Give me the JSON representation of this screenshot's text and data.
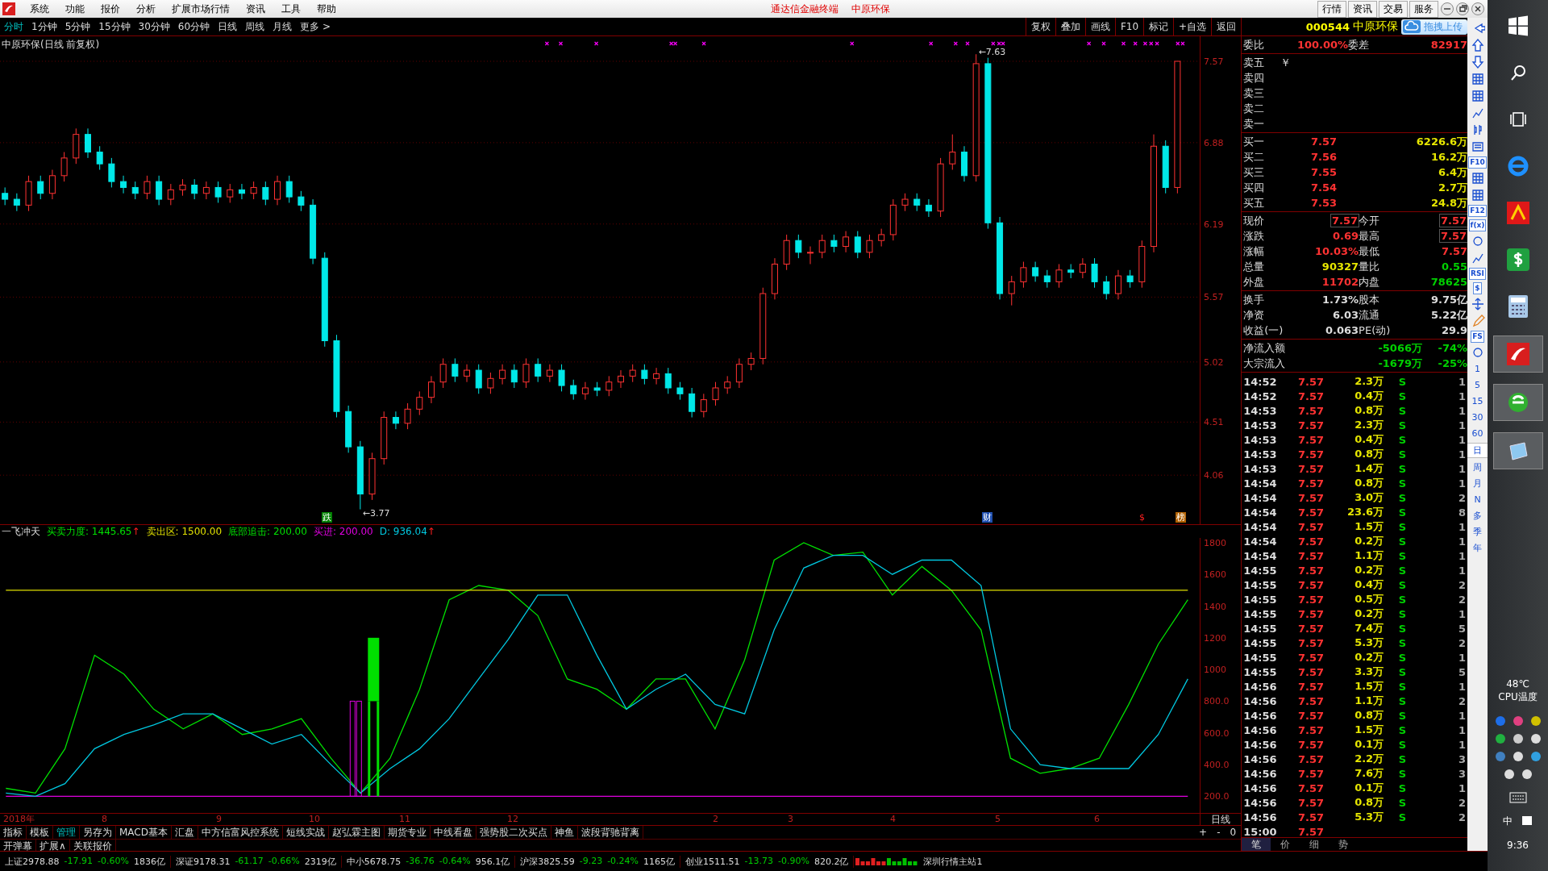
{
  "menu": {
    "items": [
      "系统",
      "功能",
      "报价",
      "分析",
      "扩展市场行情",
      "资讯",
      "工具",
      "帮助"
    ],
    "title_right": [
      "通达信金融终端",
      "中原环保"
    ],
    "buttons": [
      "行情",
      "资讯",
      "交易",
      "服务"
    ]
  },
  "periods": [
    {
      "label": "分时",
      "selected": true
    },
    {
      "label": "1分钟",
      "selected": false
    },
    {
      "label": "5分钟",
      "selected": false
    },
    {
      "label": "15分钟",
      "selected": false
    },
    {
      "label": "30分钟",
      "selected": false
    },
    {
      "label": "60分钟",
      "selected": false
    },
    {
      "label": "日线",
      "selected": false
    },
    {
      "label": "周线",
      "selected": false
    },
    {
      "label": "月线",
      "selected": false
    },
    {
      "label": "更多 >",
      "selected": false
    }
  ],
  "chart_tools": [
    "复权",
    "叠加",
    "画线",
    "F10",
    "标记",
    "+自选",
    "返回"
  ],
  "main_chart": {
    "title": "中原环保(日线 前复权)",
    "chart_data": {
      "type": "candlestick",
      "categories": [
        null,
        null,
        null,
        null,
        null,
        null,
        null,
        null,
        null,
        null,
        null,
        null,
        null,
        null,
        null,
        null,
        null,
        null,
        null,
        null,
        null,
        null,
        null,
        null,
        null,
        null,
        null,
        null,
        null,
        null,
        null,
        null,
        null,
        null,
        null,
        null,
        null,
        null,
        null,
        null,
        null,
        null,
        null,
        null,
        null,
        null,
        null,
        null,
        null,
        null,
        null,
        null,
        null,
        null,
        null,
        null,
        null,
        null,
        null,
        null,
        null,
        null,
        null,
        null,
        null,
        null,
        null,
        null,
        null,
        null,
        null,
        null,
        null,
        null,
        null,
        null,
        null,
        null,
        null,
        null,
        null,
        null,
        null,
        null,
        null,
        null,
        null,
        null,
        null,
        null,
        null,
        null,
        null,
        null,
        null,
        null,
        null,
        null,
        null,
        null
      ],
      "ohlc": [
        [
          6.45,
          6.5,
          6.35,
          6.4
        ],
        [
          6.4,
          6.45,
          6.3,
          6.35
        ],
        [
          6.35,
          6.6,
          6.3,
          6.55
        ],
        [
          6.55,
          6.6,
          6.4,
          6.45
        ],
        [
          6.45,
          6.65,
          6.4,
          6.6
        ],
        [
          6.6,
          6.8,
          6.55,
          6.75
        ],
        [
          6.75,
          7.0,
          6.7,
          6.95
        ],
        [
          6.95,
          7.0,
          6.75,
          6.8
        ],
        [
          6.8,
          6.85,
          6.65,
          6.7
        ],
        [
          6.7,
          6.75,
          6.5,
          6.55
        ],
        [
          6.55,
          6.6,
          6.45,
          6.5
        ],
        [
          6.5,
          6.55,
          6.4,
          6.45
        ],
        [
          6.45,
          6.6,
          6.4,
          6.55
        ],
        [
          6.55,
          6.6,
          6.35,
          6.4
        ],
        [
          6.4,
          6.53,
          6.35,
          6.48
        ],
        [
          6.48,
          6.57,
          6.43,
          6.52
        ],
        [
          6.52,
          6.57,
          6.4,
          6.45
        ],
        [
          6.45,
          6.55,
          6.4,
          6.5
        ],
        [
          6.5,
          6.55,
          6.37,
          6.42
        ],
        [
          6.42,
          6.53,
          6.37,
          6.48
        ],
        [
          6.48,
          6.53,
          6.4,
          6.45
        ],
        [
          6.45,
          6.55,
          6.4,
          6.5
        ],
        [
          6.5,
          6.55,
          6.35,
          6.4
        ],
        [
          6.4,
          6.6,
          6.35,
          6.55
        ],
        [
          6.55,
          6.6,
          6.37,
          6.42
        ],
        [
          6.42,
          6.47,
          6.3,
          6.35
        ],
        [
          6.35,
          6.4,
          5.85,
          5.9
        ],
        [
          5.9,
          5.95,
          5.15,
          5.2
        ],
        [
          5.2,
          5.25,
          4.55,
          4.6
        ],
        [
          4.6,
          4.65,
          4.25,
          4.3
        ],
        [
          4.3,
          4.35,
          3.77,
          3.9
        ],
        [
          3.9,
          4.25,
          3.85,
          4.2
        ],
        [
          4.2,
          4.6,
          4.15,
          4.55
        ],
        [
          4.55,
          4.6,
          4.45,
          4.5
        ],
        [
          4.5,
          4.67,
          4.45,
          4.62
        ],
        [
          4.62,
          4.77,
          4.57,
          4.72
        ],
        [
          4.72,
          4.9,
          4.67,
          4.85
        ],
        [
          4.85,
          5.05,
          4.8,
          5.0
        ],
        [
          5.0,
          5.05,
          4.85,
          4.9
        ],
        [
          4.9,
          5.0,
          4.85,
          4.95
        ],
        [
          4.95,
          5.0,
          4.75,
          4.8
        ],
        [
          4.8,
          4.93,
          4.75,
          4.88
        ],
        [
          4.88,
          5.0,
          4.83,
          4.95
        ],
        [
          4.95,
          5.0,
          4.8,
          4.85
        ],
        [
          4.85,
          5.05,
          4.8,
          5.0
        ],
        [
          5.0,
          5.05,
          4.85,
          4.9
        ],
        [
          4.9,
          5.0,
          4.85,
          4.95
        ],
        [
          4.95,
          5.0,
          4.77,
          4.82
        ],
        [
          4.82,
          4.87,
          4.7,
          4.75
        ],
        [
          4.75,
          4.85,
          4.7,
          4.8
        ],
        [
          4.8,
          4.85,
          4.73,
          4.78
        ],
        [
          4.78,
          4.9,
          4.73,
          4.85
        ],
        [
          4.85,
          4.95,
          4.8,
          4.9
        ],
        [
          4.9,
          5.0,
          4.85,
          4.95
        ],
        [
          4.95,
          5.0,
          4.83,
          4.88
        ],
        [
          4.88,
          4.97,
          4.83,
          4.92
        ],
        [
          4.92,
          4.97,
          4.75,
          4.8
        ],
        [
          4.8,
          4.85,
          4.7,
          4.75
        ],
        [
          4.75,
          4.8,
          4.55,
          4.6
        ],
        [
          4.6,
          4.75,
          4.55,
          4.7
        ],
        [
          4.7,
          4.85,
          4.65,
          4.8
        ],
        [
          4.8,
          4.9,
          4.75,
          4.85
        ],
        [
          4.85,
          5.05,
          4.8,
          5.0
        ],
        [
          5.0,
          5.1,
          4.95,
          5.05
        ],
        [
          5.05,
          5.65,
          5.0,
          5.6
        ],
        [
          5.6,
          5.9,
          5.55,
          5.85
        ],
        [
          5.85,
          6.1,
          5.8,
          6.05
        ],
        [
          6.05,
          6.1,
          5.9,
          5.95
        ],
        [
          5.95,
          6.0,
          5.85,
          5.95
        ],
        [
          5.95,
          6.1,
          5.9,
          6.05
        ],
        [
          6.05,
          6.1,
          5.95,
          6.0
        ],
        [
          6.0,
          6.13,
          5.95,
          6.08
        ],
        [
          6.08,
          6.13,
          5.9,
          5.95
        ],
        [
          5.95,
          6.1,
          5.9,
          6.05
        ],
        [
          6.05,
          6.15,
          6.0,
          6.1
        ],
        [
          6.1,
          6.4,
          6.05,
          6.35
        ],
        [
          6.35,
          6.45,
          6.3,
          6.4
        ],
        [
          6.4,
          6.45,
          6.3,
          6.35
        ],
        [
          6.35,
          6.4,
          6.25,
          6.3
        ],
        [
          6.3,
          6.75,
          6.25,
          6.7
        ],
        [
          6.7,
          6.95,
          6.65,
          6.8
        ],
        [
          6.8,
          6.85,
          6.55,
          6.6
        ],
        [
          6.6,
          7.63,
          6.55,
          7.55
        ],
        [
          7.55,
          7.6,
          6.15,
          6.2
        ],
        [
          6.2,
          6.25,
          5.55,
          5.6
        ],
        [
          5.6,
          5.75,
          5.5,
          5.7
        ],
        [
          5.7,
          5.87,
          5.65,
          5.82
        ],
        [
          5.82,
          5.87,
          5.7,
          5.75
        ],
        [
          5.75,
          5.8,
          5.65,
          5.7
        ],
        [
          5.7,
          5.85,
          5.65,
          5.8
        ],
        [
          5.8,
          5.85,
          5.73,
          5.78
        ],
        [
          5.78,
          5.9,
          5.73,
          5.85
        ],
        [
          5.85,
          5.9,
          5.65,
          5.7
        ],
        [
          5.7,
          5.75,
          5.55,
          5.6
        ],
        [
          5.6,
          5.8,
          5.55,
          5.75
        ],
        [
          5.75,
          5.8,
          5.65,
          5.7
        ],
        [
          5.7,
          6.05,
          5.65,
          6.0
        ],
        [
          6.0,
          6.95,
          5.95,
          6.85
        ],
        [
          6.85,
          6.9,
          6.45,
          6.5
        ],
        [
          6.5,
          7.57,
          6.45,
          7.57
        ]
      ],
      "ylim": [
        3.644,
        7.782
      ],
      "grid": true,
      "yticks": [
        7.57,
        6.88,
        6.19,
        5.57,
        5.02,
        4.51,
        4.06
      ]
    },
    "high_label": "←7.63",
    "low_label": "←3.77",
    "markers": [
      {
        "text": "跌",
        "color": "#008000"
      },
      {
        "text": "财",
        "color": "#2050b0"
      },
      {
        "text": "$",
        "color": "#000000"
      },
      {
        "text": "榜",
        "color": "#b06000"
      }
    ]
  },
  "indicator": {
    "name": "一飞冲天",
    "readings": [
      {
        "kind": "series",
        "value": ": 1445.65",
        "arrow": "↑"
      },
      {
        "kind": "series",
        "value": ": 1500.00"
      },
      {
        "kind": "signal",
        "label": "底部追击",
        "value": ": 200.00",
        "color": "#00e000"
      },
      {
        "kind": "series",
        "value": ": 200.00"
      },
      {
        "kind": "series",
        "value": ": 936.04",
        "arrow": "↑"
      }
    ],
    "chart_data": {
      "type": "line",
      "categories": [
        null,
        null,
        null,
        null,
        null,
        null,
        null,
        null,
        null,
        null,
        null,
        null,
        null,
        null,
        null,
        null,
        null,
        null,
        null,
        null,
        null,
        null,
        null,
        null,
        null,
        null,
        null,
        null,
        null,
        null,
        null,
        null,
        null,
        null,
        null,
        null,
        null,
        null,
        null,
        null,
        null
      ],
      "ylim": [
        95,
        1830
      ],
      "series": [
        {
          "name": "买卖力度",
          "color": "#00e000",
          "values": [
            250,
            220,
            500,
            1090,
            970,
            750,
            625,
            720,
            590,
            625,
            690,
            440,
            220,
            440,
            875,
            1440,
            1530,
            1500,
            1340,
            940,
            875,
            750,
            940,
            940,
            625,
            1060,
            1690,
            1800,
            1720,
            1740,
            1470,
            1650,
            1500,
            1250,
            440,
            345,
            375,
            440,
            780,
            1160,
            1440
          ]
        },
        {
          "name": "卖出区",
          "color": "#e0e000",
          "values": [
            1500,
            1500,
            1500,
            1500,
            1500,
            1500,
            1500,
            1500,
            1500,
            1500,
            1500,
            1500,
            1500,
            1500,
            1500,
            1500,
            1500,
            1500,
            1500,
            1500,
            1500,
            1500,
            1500,
            1500,
            1500,
            1500,
            1500,
            1500,
            1500,
            1500,
            1500,
            1500,
            1500,
            1500,
            1500,
            1500,
            1500,
            1500,
            1500,
            1500,
            1500
          ]
        },
        {
          "name": "买进",
          "color": "#e000e0",
          "values": [
            200,
            200,
            200,
            200,
            200,
            200,
            200,
            200,
            200,
            200,
            200,
            200,
            200,
            200,
            200,
            200,
            200,
            200,
            200,
            200,
            200,
            200,
            200,
            200,
            200,
            200,
            200,
            200,
            200,
            200,
            200,
            200,
            200,
            200,
            200,
            200,
            200,
            200,
            200,
            200,
            200
          ]
        },
        {
          "name": "D",
          "color": "#00c8e0",
          "values": [
            220,
            200,
            280,
            500,
            590,
            650,
            720,
            720,
            625,
            530,
            590,
            400,
            220,
            375,
            500,
            690,
            940,
            1190,
            1470,
            1470,
            1090,
            750,
            875,
            970,
            780,
            720,
            1250,
            1640,
            1720,
            1720,
            1600,
            1690,
            1690,
            1530,
            625,
            400,
            375,
            375,
            375,
            590,
            940
          ]
        }
      ],
      "yticks": [
        {
          "value": 1800,
          "label": "1800"
        },
        {
          "value": 1600,
          "label": "1600"
        },
        {
          "value": 1400,
          "label": "1400"
        },
        {
          "value": 1200,
          "label": "1200"
        },
        {
          "value": 1000,
          "label": "1000"
        },
        {
          "value": 800,
          "label": "800.0"
        },
        {
          "value": 600,
          "label": "600.0"
        },
        {
          "value": 400,
          "label": "400.0"
        },
        {
          "value": 200,
          "label": "200.0"
        }
      ]
    }
  },
  "date_axis": {
    "labels": [
      "2018年",
      "8",
      "9",
      "10",
      "11",
      "12",
      "2",
      "3",
      "4",
      "5",
      "6"
    ],
    "period": "日线"
  },
  "tabs": [
    {
      "label": "指标",
      "selected": false
    },
    {
      "label": "模板",
      "selected": false
    },
    {
      "label": "管理",
      "selected": true
    },
    {
      "label": "另存为",
      "selected": false
    },
    {
      "label": "MACD基本",
      "selected": false
    },
    {
      "label": "汇盘",
      "selected": false
    },
    {
      "label": "中方信富风控系统",
      "selected": false
    },
    {
      "label": "短线实战",
      "selected": false
    },
    {
      "label": "赵弘霖主图",
      "selected": false
    },
    {
      "label": "期货专业",
      "selected": false
    },
    {
      "label": "中线看盘",
      "selected": false
    },
    {
      "label": "强势股二次买点",
      "selected": false
    },
    {
      "label": "神鱼",
      "selected": false
    },
    {
      "label": "波段背驰背离",
      "selected": false
    }
  ],
  "tab_controls": [
    "+",
    "-",
    "0"
  ],
  "tabs2": [
    "开弹幕",
    "扩展∧",
    "关联报价"
  ],
  "quote": {
    "code": "000544",
    "name": "中原环保",
    "upload_button": "拖拽上传",
    "ratio": [
      {
        "label": "委比",
        "value": "100.00%"
      },
      {
        "label": "委差",
        "value": "82917"
      }
    ],
    "sell": [
      {
        "label": "卖五",
        "mark": "￥"
      },
      {
        "label": "卖四"
      },
      {
        "label": "卖三"
      },
      {
        "label": "卖二"
      },
      {
        "label": "卖一"
      }
    ],
    "buy": [
      {
        "label": "买一",
        "price": "7.57",
        "volume": "6226.6万"
      },
      {
        "label": "买二",
        "price": "7.56",
        "volume": "16.2万"
      },
      {
        "label": "买三",
        "price": "7.55",
        "volume": "6.4万"
      },
      {
        "label": "买四",
        "price": "7.54",
        "volume": "2.7万"
      },
      {
        "label": "买五",
        "price": "7.53",
        "volume": "24.8万"
      }
    ],
    "stats": [
      [
        {
          "label": "现价",
          "value": "7.57",
          "color": "#ff3232",
          "boxed": true
        },
        {
          "label": "今开",
          "value": "7.57",
          "color": "#ff3232",
          "boxed": true
        }
      ],
      [
        {
          "label": "涨跌",
          "value": "0.69",
          "color": "#ff3232",
          "boxed": false
        },
        {
          "label": "最高",
          "value": "7.57",
          "color": "#ff3232",
          "boxed": true
        }
      ],
      [
        {
          "label": "涨幅",
          "value": "10.03%",
          "color": "#ff3232",
          "boxed": false
        },
        {
          "label": "最低",
          "value": "7.57",
          "color": "#ff3232",
          "boxed": false
        }
      ],
      [
        {
          "label": "总量",
          "value": "90327",
          "color": "#e6e600",
          "boxed": false
        },
        {
          "label": "量比",
          "value": "0.55",
          "color": "#00d000",
          "boxed": false
        }
      ],
      [
        {
          "label": "外盘",
          "value": "11702",
          "color": "#ff3232",
          "boxed": false
        },
        {
          "label": "内盘",
          "value": "78625",
          "color": "#00d000",
          "boxed": false
        }
      ]
    ],
    "fundamentals": [
      [
        {
          "label": "换手",
          "value": "1.73%"
        },
        {
          "label": "股本",
          "value": "9.75亿"
        }
      ],
      [
        {
          "label": "净资",
          "value": "6.03"
        },
        {
          "label": "流通",
          "value": "5.22亿"
        }
      ],
      [
        {
          "label": "收益(一)",
          "value": "0.063"
        },
        {
          "label": "PE(动)",
          "value": "29.9"
        }
      ]
    ],
    "flows": [
      {
        "label": "净流入额",
        "amount": "-5066万",
        "pct": "-74%"
      },
      {
        "label": "大宗流入",
        "amount": "-1679万",
        "pct": "-25%"
      }
    ],
    "ticks": [
      {
        "time": "14:52",
        "price": "7.57",
        "volume": "2.3万",
        "side": "S",
        "count": "1"
      },
      {
        "time": "14:52",
        "price": "7.57",
        "volume": "0.4万",
        "side": "S",
        "count": "1"
      },
      {
        "time": "14:53",
        "price": "7.57",
        "volume": "0.8万",
        "side": "S",
        "count": "1"
      },
      {
        "time": "14:53",
        "price": "7.57",
        "volume": "2.3万",
        "side": "S",
        "count": "1"
      },
      {
        "time": "14:53",
        "price": "7.57",
        "volume": "0.4万",
        "side": "S",
        "count": "1"
      },
      {
        "time": "14:53",
        "price": "7.57",
        "volume": "0.8万",
        "side": "S",
        "count": "1"
      },
      {
        "time": "14:53",
        "price": "7.57",
        "volume": "1.4万",
        "side": "S",
        "count": "1"
      },
      {
        "time": "14:54",
        "price": "7.57",
        "volume": "0.8万",
        "side": "S",
        "count": "1"
      },
      {
        "time": "14:54",
        "price": "7.57",
        "volume": "3.0万",
        "side": "S",
        "count": "2"
      },
      {
        "time": "14:54",
        "price": "7.57",
        "volume": "23.6万",
        "side": "S",
        "count": "8"
      },
      {
        "time": "14:54",
        "price": "7.57",
        "volume": "1.5万",
        "side": "S",
        "count": "1"
      },
      {
        "time": "14:54",
        "price": "7.57",
        "volume": "0.2万",
        "side": "S",
        "count": "1"
      },
      {
        "time": "14:54",
        "price": "7.57",
        "volume": "1.1万",
        "side": "S",
        "count": "1"
      },
      {
        "time": "14:55",
        "price": "7.57",
        "volume": "0.2万",
        "side": "S",
        "count": "1"
      },
      {
        "time": "14:55",
        "price": "7.57",
        "volume": "0.4万",
        "side": "S",
        "count": "2"
      },
      {
        "time": "14:55",
        "price": "7.57",
        "volume": "0.5万",
        "side": "S",
        "count": "2"
      },
      {
        "time": "14:55",
        "price": "7.57",
        "volume": "0.2万",
        "side": "S",
        "count": "1"
      },
      {
        "time": "14:55",
        "price": "7.57",
        "volume": "7.4万",
        "side": "S",
        "count": "5"
      },
      {
        "time": "14:55",
        "price": "7.57",
        "volume": "5.3万",
        "side": "S",
        "count": "2"
      },
      {
        "time": "14:55",
        "price": "7.57",
        "volume": "0.2万",
        "side": "S",
        "count": "1"
      },
      {
        "time": "14:55",
        "price": "7.57",
        "volume": "3.3万",
        "side": "S",
        "count": "5"
      },
      {
        "time": "14:56",
        "price": "7.57",
        "volume": "1.5万",
        "side": "S",
        "count": "1"
      },
      {
        "time": "14:56",
        "price": "7.57",
        "volume": "1.1万",
        "side": "S",
        "count": "2"
      },
      {
        "time": "14:56",
        "price": "7.57",
        "volume": "0.8万",
        "side": "S",
        "count": "1"
      },
      {
        "time": "14:56",
        "price": "7.57",
        "volume": "1.5万",
        "side": "S",
        "count": "1"
      },
      {
        "time": "14:56",
        "price": "7.57",
        "volume": "0.1万",
        "side": "S",
        "count": "1"
      },
      {
        "time": "14:56",
        "price": "7.57",
        "volume": "2.2万",
        "side": "S",
        "count": "3"
      },
      {
        "time": "14:56",
        "price": "7.57",
        "volume": "7.6万",
        "side": "S",
        "count": "3"
      },
      {
        "time": "14:56",
        "price": "7.57",
        "volume": "0.1万",
        "side": "S",
        "count": "1"
      },
      {
        "time": "14:56",
        "price": "7.57",
        "volume": "0.8万",
        "side": "S",
        "count": "2"
      },
      {
        "time": "14:56",
        "price": "7.57",
        "volume": "5.3万",
        "side": "S",
        "count": "2"
      },
      {
        "time": "15:00",
        "price": "7.57"
      }
    ],
    "bottom_tabs": [
      {
        "label": "笔",
        "selected": true
      },
      {
        "label": "价",
        "selected": false
      },
      {
        "label": "细",
        "selected": false
      },
      {
        "label": "势",
        "selected": false
      }
    ]
  },
  "side_toolbar": [
    {
      "kind": "arrow-left"
    },
    {
      "kind": "arrow-up"
    },
    {
      "kind": "arrow-down"
    },
    {
      "kind": "grid"
    },
    {
      "kind": "grid"
    },
    {
      "kind": "line"
    },
    {
      "kind": "candles"
    },
    {
      "kind": "list"
    },
    {
      "kind": "text",
      "text": "F10"
    },
    {
      "kind": "grid"
    },
    {
      "kind": "grid"
    },
    {
      "kind": "text",
      "text": "F12"
    },
    {
      "kind": "text",
      "text": "f(x)"
    },
    {
      "kind": "circle"
    },
    {
      "kind": "line"
    },
    {
      "kind": "text",
      "text": "RSI"
    },
    {
      "kind": "text",
      "text": "$"
    },
    {
      "kind": "move"
    },
    {
      "kind": "pencil"
    },
    {
      "kind": "text",
      "text": "FS"
    },
    {
      "kind": "circle"
    },
    {
      "kind": "period",
      "text": "1",
      "selected": false
    },
    {
      "kind": "period",
      "text": "5",
      "selected": false
    },
    {
      "kind": "period",
      "text": "15",
      "selected": false
    },
    {
      "kind": "period",
      "text": "30",
      "selected": false
    },
    {
      "kind": "period",
      "text": "60",
      "selected": false
    },
    {
      "kind": "period",
      "text": "日",
      "selected": true
    },
    {
      "kind": "period",
      "text": "周",
      "selected": false
    },
    {
      "kind": "period",
      "text": "月",
      "selected": false
    },
    {
      "kind": "period",
      "text": "N",
      "selected": false
    },
    {
      "kind": "period",
      "text": "多",
      "selected": false
    },
    {
      "kind": "period",
      "text": "季",
      "selected": false
    },
    {
      "kind": "period",
      "text": "年",
      "selected": false
    }
  ],
  "status_bar": {
    "indices": [
      {
        "name": "上证",
        "value": "2978.88",
        "change": "-17.91",
        "pct": "-0.60%",
        "amount": "1836亿"
      },
      {
        "name": "深证",
        "value": "9178.31",
        "change": "-61.17",
        "pct": "-0.66%",
        "amount": "2319亿"
      },
      {
        "name": "中小",
        "value": "5678.75",
        "change": "-36.76",
        "pct": "-0.64%",
        "amount": "956.1亿"
      },
      {
        "name": "沪深",
        "value": "3825.59",
        "change": "-9.23",
        "pct": "-0.24%",
        "amount": "1165亿"
      },
      {
        "name": "创业",
        "value": "1511.51",
        "change": "-13.73",
        "pct": "-0.90%",
        "amount": "820.2亿"
      }
    ],
    "server": "深圳行情主站1"
  },
  "taskbar": {
    "temperature": "48℃",
    "temp_label": "CPU温度",
    "ime": "中",
    "time": "9:36"
  }
}
